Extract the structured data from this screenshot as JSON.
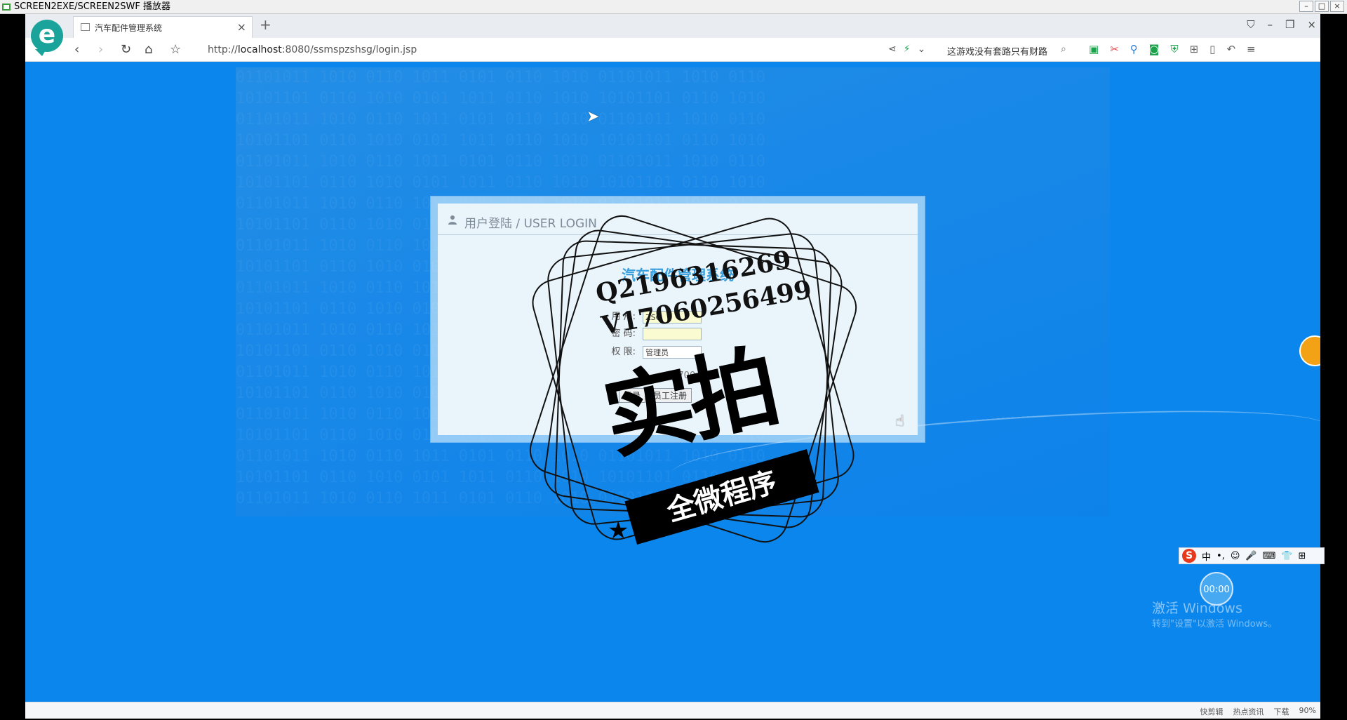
{
  "player": {
    "title": "SCREEN2EXE/SCREEN2SWF 播放器",
    "btn_min": "–",
    "btn_max": "□",
    "btn_close": "×"
  },
  "browser": {
    "tab_label": "汽车配件管理系统",
    "tab_close": "×",
    "new_tab": "+",
    "url_prefix": "http://",
    "url_host": "localhost",
    "url_rest": ":8080/ssmspzshsg/login.jsp",
    "search_text": "这游戏没有套路只有财路",
    "win_controls": {
      "shirt": "⛉",
      "min": "–",
      "restore": "❐",
      "close": "×"
    }
  },
  "login": {
    "header_title": "用户登陆 / USER LOGIN",
    "system_title": "汽车配件管理系统",
    "user_label": "用 户:",
    "user_value": "ZSG",
    "pass_label": "密 码:",
    "role_label": "权 限:",
    "role_value": "管理员",
    "version": "1.700",
    "btn_login": "登录",
    "btn_register": "员工注册"
  },
  "watermark": {
    "qq": "Q2196316269",
    "wx": "V17060256499",
    "big": "实拍",
    "ribbon": "全微程序"
  },
  "widgets": {
    "timer": "00:00",
    "ime_chinese": "中",
    "windows_line1": "激活 Windows",
    "windows_line2": "转到\"设置\"以激活 Windows。"
  },
  "status": {
    "items": [
      "快剪辑",
      "热点资讯",
      "下载",
      "90%"
    ]
  },
  "colors": {
    "page_bg": "#0b86ec",
    "accent": "#3a9fdc"
  }
}
